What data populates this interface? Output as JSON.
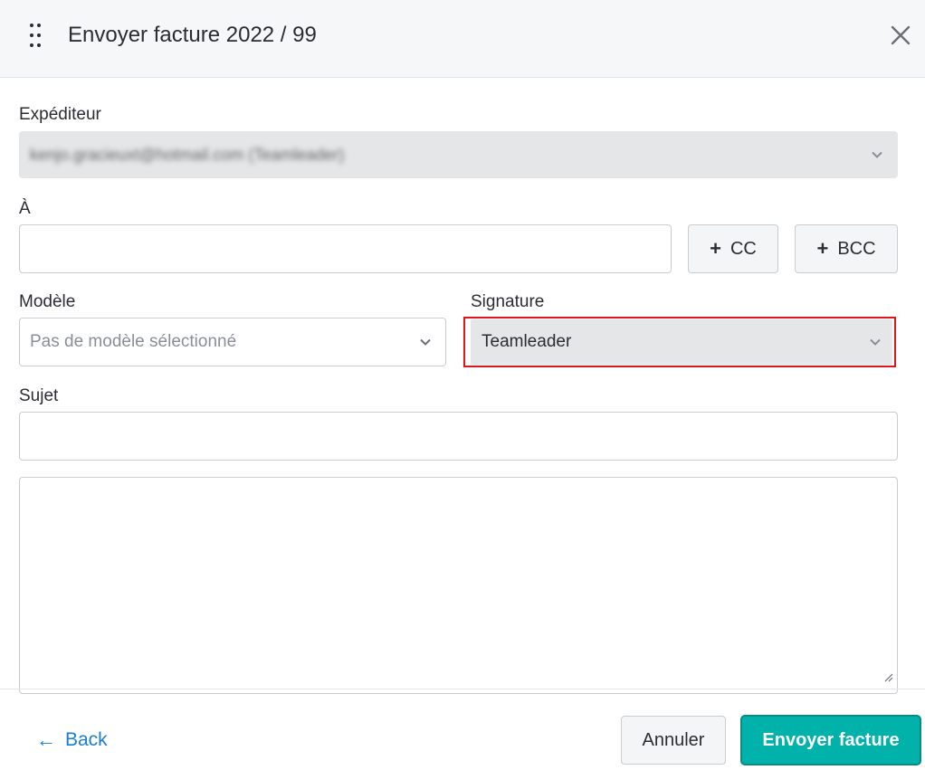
{
  "dialog": {
    "title": "Envoyer facture 2022 / 99"
  },
  "form": {
    "sender_label": "Expéditeur",
    "sender_value": "kenjo.gracieuxt@hotmail.com (Teamleader)",
    "to_label": "À",
    "to_value": "",
    "cc_label": "CC",
    "bcc_label": "BCC",
    "template_label": "Modèle",
    "template_placeholder": "Pas de modèle sélectionné",
    "signature_label": "Signature",
    "signature_value": "Teamleader",
    "subject_label": "Sujet",
    "subject_value": "",
    "body_value": ""
  },
  "footer": {
    "back_label": "Back",
    "cancel_label": "Annuler",
    "send_label": "Envoyer facture"
  },
  "colors": {
    "primary": "#00b2a9",
    "link": "#1b7ed6",
    "highlight": "#e0161b"
  }
}
